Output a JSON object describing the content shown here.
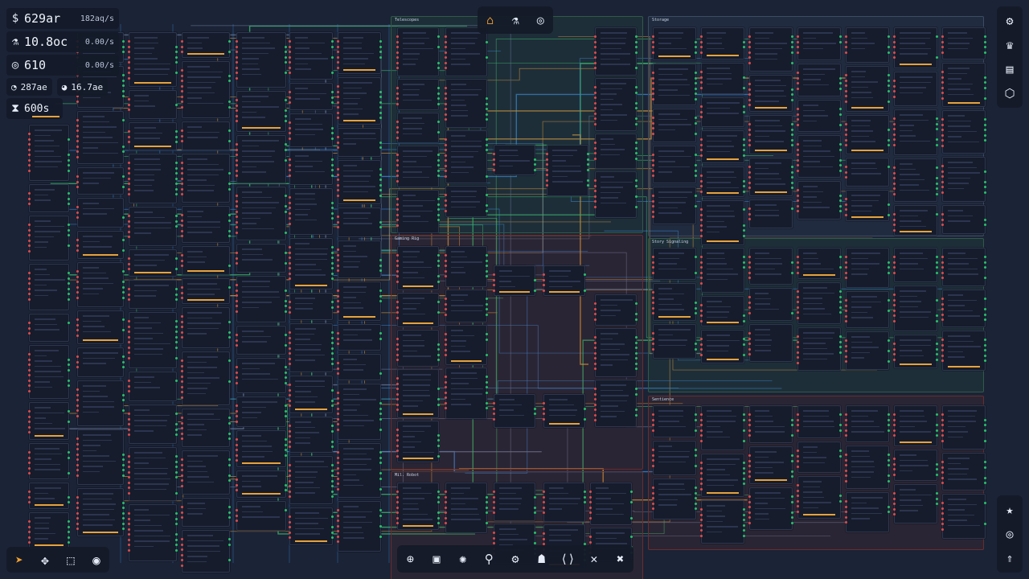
{
  "resources": {
    "money": {
      "icon": "dollar-icon",
      "value": "629ar",
      "rate": "182aq/s"
    },
    "research": {
      "icon": "flask-icon",
      "value": "10.8oc",
      "rate": "0.00/s"
    },
    "cycles": {
      "icon": "target-icon",
      "value": "610",
      "rate": "0.00/s"
    },
    "stat_a": {
      "icon": "pie-icon",
      "value": "287ae"
    },
    "stat_b": {
      "icon": "gauge-icon",
      "value": "16.7ae"
    },
    "timer": {
      "icon": "hourglass-icon",
      "value": "600s"
    }
  },
  "top_tabs": [
    {
      "name": "home-tab",
      "icon": "home-icon",
      "glyph": "⌂",
      "active": true
    },
    {
      "name": "research-tab",
      "icon": "flask-icon",
      "glyph": "⚗",
      "active": false
    },
    {
      "name": "cycle-tab",
      "icon": "aperture-icon",
      "glyph": "◎",
      "active": false
    }
  ],
  "right_tabs": [
    {
      "name": "settings-button",
      "icon": "gear-icon",
      "glyph": "⚙"
    },
    {
      "name": "achievements-button",
      "icon": "trophy-icon",
      "glyph": "♛"
    },
    {
      "name": "codex-button",
      "icon": "book-icon",
      "glyph": "▤"
    },
    {
      "name": "modules-button",
      "icon": "hexagon-icon",
      "glyph": "⬡"
    }
  ],
  "right_tabs_bottom": [
    {
      "name": "favorites-button",
      "icon": "star-icon",
      "glyph": "★"
    },
    {
      "name": "focus-button",
      "icon": "target-icon",
      "glyph": "◎"
    },
    {
      "name": "upgrade-button",
      "icon": "chevrons-up-icon",
      "glyph": "⇑"
    }
  ],
  "tools": [
    {
      "name": "select-tool",
      "icon": "cursor-icon",
      "glyph": "➤",
      "active": true
    },
    {
      "name": "pan-tool",
      "icon": "move-icon",
      "glyph": "✥",
      "active": false
    },
    {
      "name": "marquee-tool",
      "icon": "marquee-icon",
      "glyph": "⬚",
      "active": false
    },
    {
      "name": "target-tool",
      "icon": "target-icon",
      "glyph": "◉",
      "active": false
    }
  ],
  "bottom_tools": [
    {
      "name": "network-button",
      "icon": "globe-icon",
      "glyph": "⊕"
    },
    {
      "name": "chip-button",
      "icon": "chip-icon",
      "glyph": "▣"
    },
    {
      "name": "brain-button",
      "icon": "brain-icon",
      "glyph": "✺"
    },
    {
      "name": "microscope-button",
      "icon": "microscope-icon",
      "glyph": "⚲"
    },
    {
      "name": "robot-arm-button",
      "icon": "robot-arm-icon",
      "glyph": "⚙"
    },
    {
      "name": "agent-button",
      "icon": "agent-icon",
      "glyph": "☗"
    },
    {
      "name": "code-button",
      "icon": "code-icon",
      "glyph": "⟨⟩"
    },
    {
      "name": "tools-button",
      "icon": "tools-icon",
      "glyph": "✕"
    },
    {
      "name": "delete-button",
      "icon": "close-icon",
      "glyph": "✖"
    }
  ],
  "groups": [
    {
      "title": "Storage",
      "color": "#3a4d63"
    },
    {
      "title": "Telescopes",
      "color": "#2f5a45"
    },
    {
      "title": "Gaming Rig",
      "color": "#6a2d2d"
    },
    {
      "title": "Mil. Robot",
      "color": "#6a2d2d"
    },
    {
      "title": "Story Signaling",
      "color": "#2f5a45"
    },
    {
      "title": "Sentience",
      "color": "#6a2d2d"
    }
  ],
  "colors": {
    "accent": "#f0a030",
    "input_port": "#e04a4a",
    "output_port": "#26c26a",
    "wire_blue": "#3a8de0",
    "wire_orange": "#e8a23a",
    "wire_green": "#3cc070"
  }
}
